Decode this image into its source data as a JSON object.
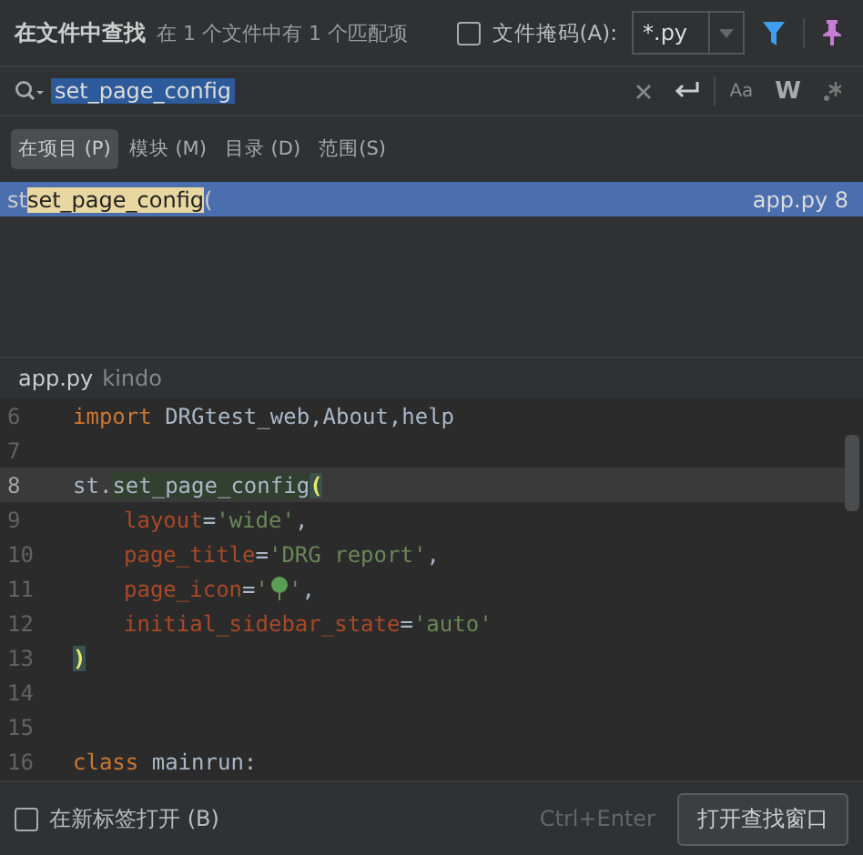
{
  "header": {
    "title": "在文件中查找",
    "summary": "在 1 个文件中有 1 个匹配项",
    "file_mask": {
      "label": "文件掩码(A):",
      "checked": false,
      "value": "*.py"
    }
  },
  "search": {
    "value": "set_page_config",
    "options": [
      "Aa",
      "W"
    ]
  },
  "scopes": [
    {
      "label": "在项目 (P)",
      "selected": true
    },
    {
      "label": "模块 (M)",
      "selected": false
    },
    {
      "label": "目录 (D)",
      "selected": false
    },
    {
      "label": "范围(S)",
      "selected": false
    }
  ],
  "results": [
    {
      "prefix": "st",
      "match": "set_page_config",
      "suffix": "(",
      "location": "app.py 8",
      "selected": true
    }
  ],
  "preview": {
    "file": "app.py",
    "folder": "kindo",
    "lines": [
      {
        "number": "6",
        "current": false,
        "tokens": [
          {
            "kind": "keyword",
            "text": "import"
          },
          {
            "kind": "plain",
            "text": " DRGtest_web,About,help"
          }
        ]
      },
      {
        "number": "7",
        "current": false
      },
      {
        "number": "8",
        "current": true,
        "tokens": [
          {
            "kind": "plain",
            "text": "st."
          },
          {
            "kind": "match",
            "text": "set_page_config"
          },
          {
            "kind": "bracket",
            "text": "("
          }
        ]
      },
      {
        "number": "9",
        "current": false,
        "tokens": [
          {
            "kind": "indent"
          },
          {
            "kind": "param",
            "text": "layout"
          },
          {
            "kind": "plain",
            "text": "="
          },
          {
            "kind": "string",
            "text": "'wide'"
          },
          {
            "kind": "plain",
            "text": ","
          }
        ]
      },
      {
        "number": "10",
        "current": false,
        "tokens": [
          {
            "kind": "indent"
          },
          {
            "kind": "param",
            "text": "page_title"
          },
          {
            "kind": "plain",
            "text": "="
          },
          {
            "kind": "string",
            "text": "'DRG report'"
          },
          {
            "kind": "plain",
            "text": ","
          }
        ]
      },
      {
        "number": "11",
        "current": false,
        "tokens": [
          {
            "kind": "indent"
          },
          {
            "kind": "param",
            "text": "page_icon"
          },
          {
            "kind": "plain",
            "text": "="
          },
          {
            "kind": "string",
            "text": "'"
          },
          {
            "kind": "balloon"
          },
          {
            "kind": "string",
            "text": "'"
          },
          {
            "kind": "plain",
            "text": ","
          }
        ]
      },
      {
        "number": "12",
        "current": false,
        "tokens": [
          {
            "kind": "indent"
          },
          {
            "kind": "param",
            "text": "initial_sidebar_state"
          },
          {
            "kind": "plain",
            "text": "="
          },
          {
            "kind": "string",
            "text": "'auto'"
          }
        ]
      },
      {
        "number": "13",
        "current": false,
        "tokens": [
          {
            "kind": "bracket",
            "text": ")"
          }
        ]
      },
      {
        "number": "14",
        "current": false
      },
      {
        "number": "15",
        "current": false
      },
      {
        "number": "16",
        "current": false,
        "tokens": [
          {
            "kind": "keyword",
            "text": "class"
          },
          {
            "kind": "plain",
            "text": " mainrun:"
          }
        ]
      }
    ]
  },
  "footer": {
    "new_tab": {
      "label": "在新标签打开 (B)",
      "checked": false
    },
    "shortcut": "Ctrl+Enter",
    "button": "打开查找窗口"
  }
}
